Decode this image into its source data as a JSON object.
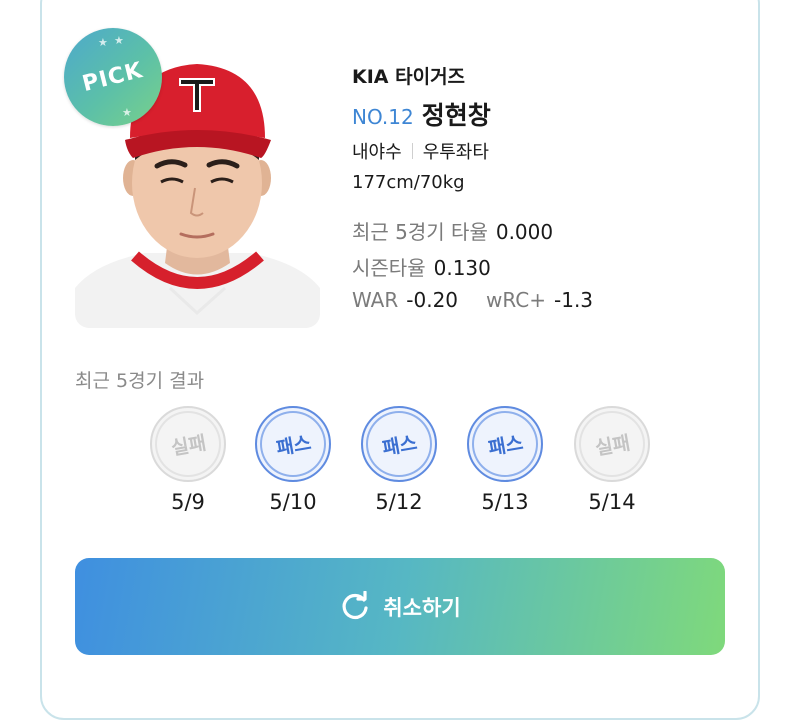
{
  "badge": {
    "label": "PICK"
  },
  "player": {
    "team": "KIA 타이거즈",
    "number": "NO.12",
    "name": "정현창",
    "position": "내야수",
    "bats_throws": "우투좌타",
    "physical": "177cm/70kg"
  },
  "stats": {
    "recent5_label": "최근 5경기 타율",
    "recent5_value": "0.000",
    "season_label": "시즌타율",
    "season_value": "0.130",
    "war_label": "WAR",
    "war_value": "-0.20",
    "wrc_label": "wRC+",
    "wrc_value": "-1.3"
  },
  "recent_results": {
    "title": "최근 5경기 결과",
    "games": [
      {
        "result": "실패",
        "status": "fail",
        "date": "5/9"
      },
      {
        "result": "패스",
        "status": "pass",
        "date": "5/10"
      },
      {
        "result": "패스",
        "status": "pass",
        "date": "5/12"
      },
      {
        "result": "패스",
        "status": "pass",
        "date": "5/13"
      },
      {
        "result": "실패",
        "status": "fail",
        "date": "5/14"
      }
    ]
  },
  "action": {
    "cancel_label": "취소하기",
    "icon": "refresh-icon"
  },
  "colors": {
    "accent_blue": "#3e86d4",
    "gradient_start": "#3f8fe0",
    "gradient_end": "#7fd97b",
    "pass_blue": "#3b6fd1",
    "fail_gray": "#c4c4c4"
  }
}
